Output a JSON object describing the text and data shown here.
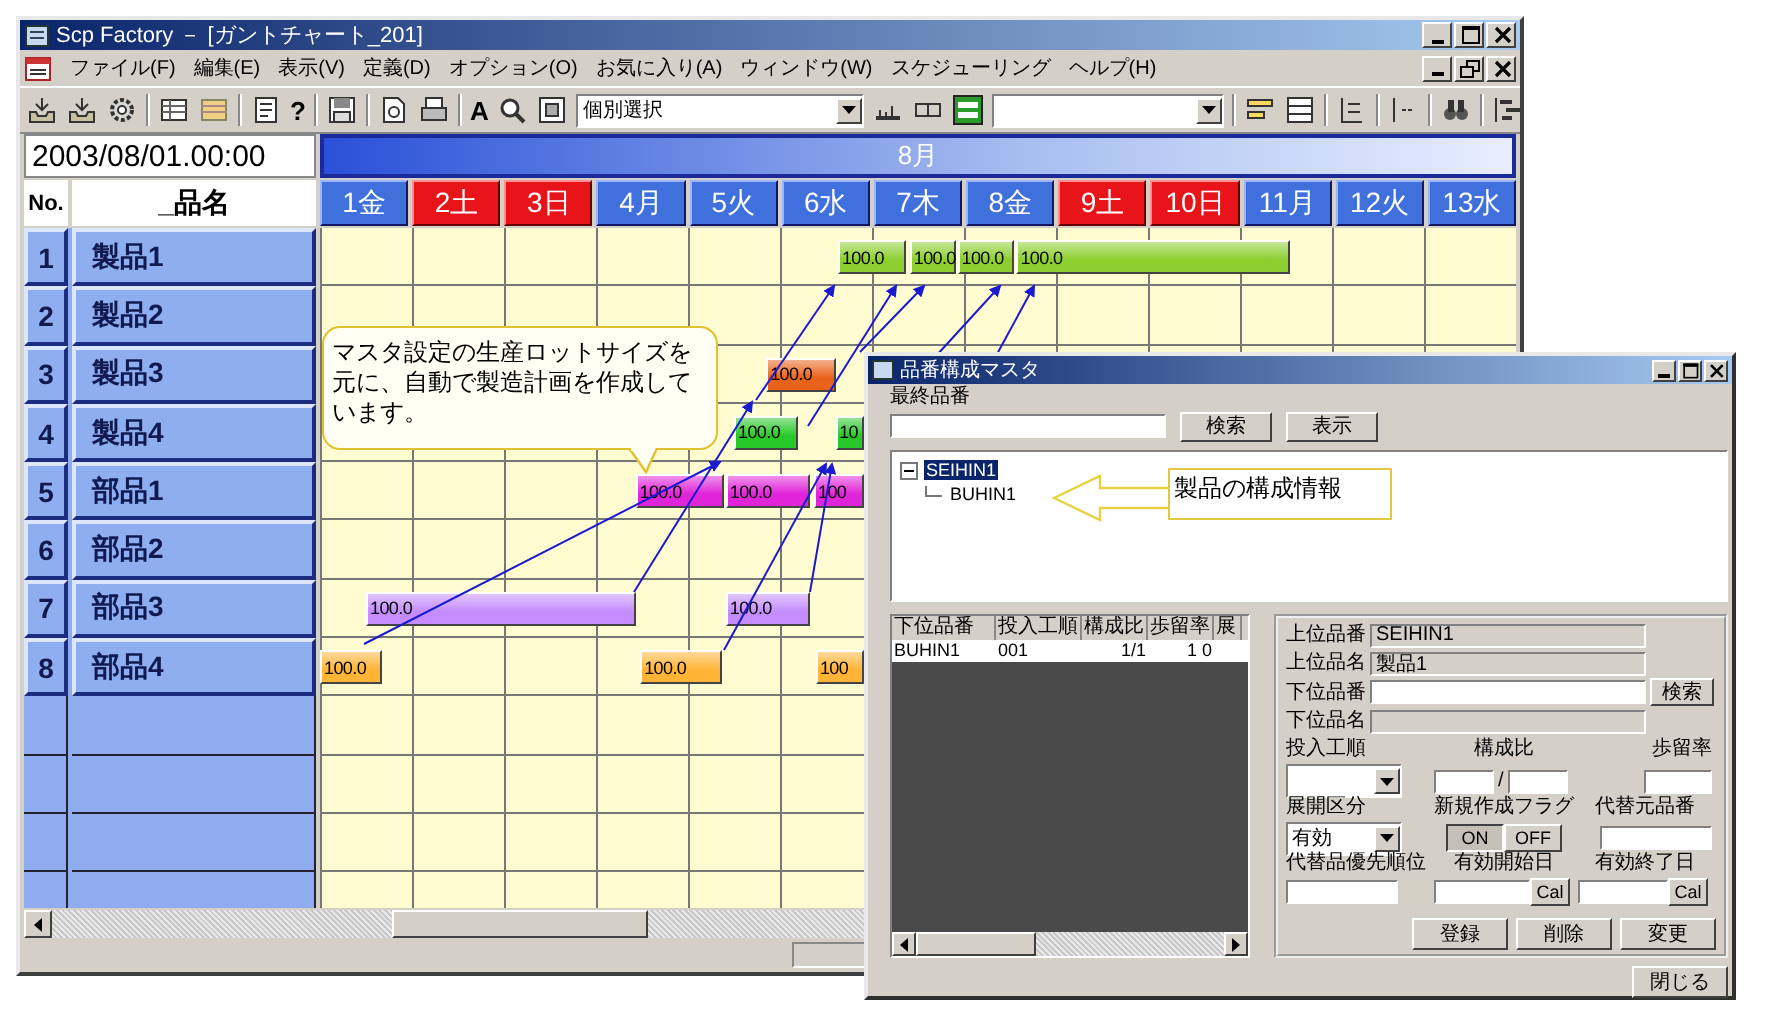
{
  "window": {
    "title": "Scp Factory － [ガントチャート_201]"
  },
  "menu": [
    "ファイル(F)",
    "編集(E)",
    "表示(V)",
    "定義(D)",
    "オプション(O)",
    "お気に入り(A)",
    "ウィンドウ(W)",
    "スケジューリング",
    "ヘルプ(H)"
  ],
  "toolbar": {
    "help_label": "?",
    "font_label": "A",
    "selection_combo": "個別選択"
  },
  "date_field": "2003/08/01.00:00",
  "month": "8月",
  "columns": {
    "number": "No.",
    "name": "_品名"
  },
  "days": [
    {
      "label": "1金",
      "holiday": false
    },
    {
      "label": "2土",
      "holiday": true
    },
    {
      "label": "3日",
      "holiday": true
    },
    {
      "label": "4月",
      "holiday": false
    },
    {
      "label": "5火",
      "holiday": false
    },
    {
      "label": "6水",
      "holiday": false
    },
    {
      "label": "7木",
      "holiday": false
    },
    {
      "label": "8金",
      "holiday": false
    },
    {
      "label": "9土",
      "holiday": true
    },
    {
      "label": "10日",
      "holiday": true
    },
    {
      "label": "11月",
      "holiday": false
    },
    {
      "label": "12火",
      "holiday": false
    },
    {
      "label": "13水",
      "holiday": false
    }
  ],
  "rows": [
    {
      "number": "1",
      "name": "製品1",
      "bars": [
        {
          "label": "100.0",
          "color": "#8ccf2e"
        },
        {
          "label": "100.0",
          "color": "#8ccf2e"
        },
        {
          "label": "100.0",
          "color": "#8ccf2e"
        },
        {
          "label": "100.0",
          "color": "#8ccf2e"
        }
      ]
    },
    {
      "number": "2",
      "name": "製品2"
    },
    {
      "number": "3",
      "name": "製品3",
      "bars": [
        {
          "label": "100.0",
          "color": "#e8621a"
        }
      ]
    },
    {
      "number": "4",
      "name": "製品4",
      "bars": [
        {
          "label": "100.0",
          "color": "#28c828"
        },
        {
          "label": "10",
          "color": "#28c828"
        }
      ]
    },
    {
      "number": "5",
      "name": "部品1",
      "bars": [
        {
          "label": "100.0",
          "color": "#e024d8"
        },
        {
          "label": "100.0",
          "color": "#e024d8"
        },
        {
          "label": "100",
          "color": "#e024d8"
        }
      ]
    },
    {
      "number": "6",
      "name": "部品2"
    },
    {
      "number": "7",
      "name": "部品3",
      "bars": [
        {
          "label": "100.0",
          "color": "#c48cff"
        },
        {
          "label": "100.0",
          "color": "#c48cff"
        }
      ]
    },
    {
      "number": "8",
      "name": "部品4",
      "bars": [
        {
          "label": "100.0",
          "color": "#ffb436"
        },
        {
          "label": "100.0",
          "color": "#ffb436"
        },
        {
          "label": "100",
          "color": "#ffb436"
        }
      ]
    }
  ],
  "callout": "マスタ設定の生産ロットサイズを元に、自動で製造計画を作成しています。",
  "dialog": {
    "title": "品番構成マスタ",
    "final_item_label": "最終品番",
    "search_button": "検索",
    "show_button": "表示",
    "tree": [
      {
        "label": "SEIHIN1",
        "selected": true,
        "expanded": true,
        "children": [
          {
            "label": "BUHIN1",
            "selected": false
          }
        ]
      }
    ],
    "annotation": "製品の構成情報",
    "list": {
      "columns": [
        "下位品番",
        "投入工順",
        "構成比",
        "歩留率",
        "展"
      ],
      "rows": [
        [
          "BUHIN1",
          "001",
          "1/1",
          "1 0"
        ]
      ]
    },
    "form": {
      "parent_code": {
        "label": "上位品番",
        "value": "SEIHIN1",
        "readonly": true
      },
      "parent_name": {
        "label": "上位品名",
        "value": "製品1",
        "readonly": true
      },
      "child_code": {
        "label": "下位品番",
        "readonly": false,
        "button": "検索"
      },
      "child_name": {
        "label": "下位品名",
        "readonly": true
      },
      "process": {
        "label": "投入工順"
      },
      "ratio": {
        "label": "構成比",
        "separator": "/"
      },
      "yield": {
        "label": "歩留率"
      },
      "expansion": {
        "label": "展開区分",
        "value": "有効"
      },
      "new_flag": {
        "label": "新規作成フラグ",
        "options": [
          {
            "label": "ON",
            "selected": true
          },
          {
            "label": "OFF",
            "selected": false
          }
        ]
      },
      "alt_source": {
        "label": "代替元品番"
      },
      "alt_priority": {
        "label": "代替品優先順位"
      },
      "start_date": {
        "label": "有効開始日",
        "button": "Cal"
      },
      "end_date": {
        "label": "有効終了日",
        "button": "Cal"
      },
      "actions": [
        "登録",
        "削除",
        "変更"
      ]
    },
    "close_button": "閉じる"
  }
}
